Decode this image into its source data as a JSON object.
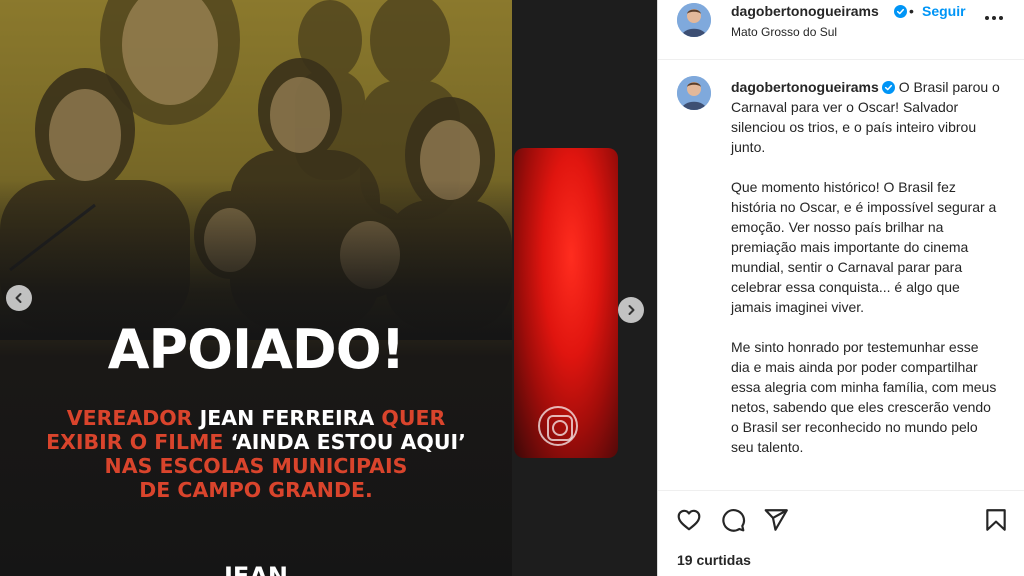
{
  "post": {
    "headline": "APOIADO!",
    "sub_parts": [
      "VEREADOR ",
      "JEAN FERREIRA",
      " QUER",
      "EXIBIR O FILME ",
      "‘AINDA ESTOU AQUI’",
      "NAS ESCOLAS MUNICIPAIS",
      "DE CAMPO GRANDE."
    ],
    "brand": "JEAN"
  },
  "header": {
    "username": "dagobertonogueirams",
    "separator": "•",
    "follow_label": "Seguir",
    "location": "Mato Grosso do Sul"
  },
  "caption": {
    "username": "dagobertonogueirams",
    "paragraphs": [
      "O Brasil parou o Carnaval para ver o Oscar! Salvador silenciou os trios, e o país inteiro vibrou junto.",
      "Que momento histórico! O Brasil fez história no Oscar, e é impossível segurar a emoção. Ver nosso país brilhar na premiação mais importante do cinema mundial, sentir o Carnaval parar para celebrar essa conquista... é algo que jamais imaginei viver.",
      "Me sinto honrado por testemunhar esse dia e mais ainda por poder compartilhar essa alegria com minha família, com meus netos, sabendo que eles crescerão vendo o Brasil ser reconhecido no mundo pelo seu talento."
    ]
  },
  "footer": {
    "likes": "19 curtidas"
  },
  "icons": {
    "prev": "chevron-left-icon",
    "next": "chevron-right-icon",
    "verified": "verified-badge-icon",
    "more": "more-horizontal-icon",
    "like": "heart-icon",
    "comment": "comment-icon",
    "share": "send-icon",
    "save": "bookmark-icon"
  },
  "colors": {
    "accent": "#0095f6",
    "verified": "#0095f6",
    "poster_orange": "#d9442c"
  }
}
